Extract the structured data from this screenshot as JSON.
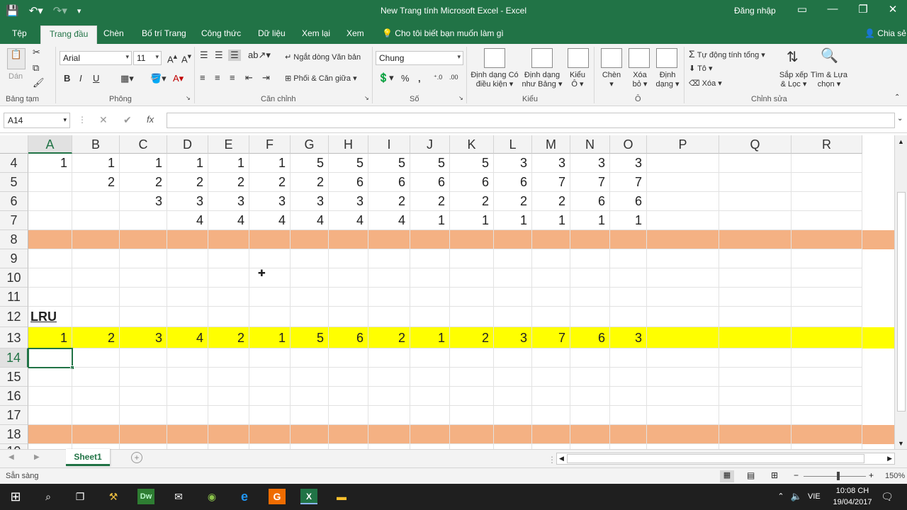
{
  "window": {
    "title": "New Trang tính Microsoft Excel  -  Excel",
    "sign_in": "Đăng nhập",
    "share": "Chia sẻ"
  },
  "tabs": [
    "Tệp",
    "Trang đầu",
    "Chèn",
    "Bố trí Trang",
    "Công thức",
    "Dữ liệu",
    "Xem lại",
    "Xem"
  ],
  "active_tab": "Trang đầu",
  "tell_me": "Cho tôi biết bạn muốn làm gì",
  "ribbon": {
    "clipboard": {
      "paste": "Dán",
      "label": "Bảng tạm"
    },
    "font": {
      "name": "Arial",
      "size": "11",
      "bold": "B",
      "italic": "I",
      "underline": "U",
      "label": "Phông"
    },
    "alignment": {
      "wrap": "Ngắt dòng Văn bản",
      "merge": "Phối & Căn giữa",
      "label": "Căn chỉnh"
    },
    "number": {
      "format": "Chung",
      "percent": "%",
      "comma": ",",
      "label": "Số"
    },
    "styles": {
      "conditional_1": "Định dạng Có",
      "conditional_2": "điều kiện",
      "table_1": "Định dạng",
      "table_2": "như Bảng",
      "cell_1": "Kiểu",
      "cell_2": "Ô",
      "label": "Kiểu"
    },
    "cells": {
      "insert": "Chèn",
      "delete_1": "Xóa",
      "delete_2": "bỏ",
      "format_1": "Định",
      "format_2": "dạng",
      "label": "Ô"
    },
    "editing": {
      "autosum": "Tự động tính tổng",
      "fill": "Tô",
      "clear": "Xóa",
      "sort_1": "Sắp xếp",
      "sort_2": "& Lọc",
      "find_1": "Tìm & Lựa",
      "find_2": "chọn",
      "label": "Chỉnh sửa"
    }
  },
  "formula_bar": {
    "name_box": "A14",
    "fx": "fx",
    "value": ""
  },
  "columns": [
    "A",
    "B",
    "C",
    "D",
    "E",
    "F",
    "G",
    "H",
    "I",
    "J",
    "K",
    "L",
    "M",
    "N",
    "O",
    "P",
    "Q",
    "R"
  ],
  "selected_column": "A",
  "rows": [
    {
      "num": "4",
      "cells": [
        "1",
        "1",
        "1",
        "1",
        "1",
        "1",
        "5",
        "5",
        "5",
        "5",
        "5",
        "3",
        "3",
        "3",
        "3"
      ]
    },
    {
      "num": "5",
      "cells": [
        "",
        "2",
        "2",
        "2",
        "2",
        "2",
        "2",
        "6",
        "6",
        "6",
        "6",
        "6",
        "7",
        "7",
        "7"
      ]
    },
    {
      "num": "6",
      "cells": [
        "",
        "",
        "3",
        "3",
        "3",
        "3",
        "3",
        "3",
        "2",
        "2",
        "2",
        "2",
        "2",
        "6",
        "6"
      ]
    },
    {
      "num": "7",
      "cells": [
        "",
        "",
        "",
        "4",
        "4",
        "4",
        "4",
        "4",
        "4",
        "1",
        "1",
        "1",
        "1",
        "1",
        "1"
      ]
    },
    {
      "num": "8",
      "cells": [],
      "fill": "#f4b183"
    },
    {
      "num": "9",
      "cells": []
    },
    {
      "num": "10",
      "cells": []
    },
    {
      "num": "11",
      "cells": []
    },
    {
      "num": "12",
      "cells": [],
      "label": "LRU"
    },
    {
      "num": "13",
      "cells": [
        "1",
        "2",
        "3",
        "4",
        "2",
        "1",
        "5",
        "6",
        "2",
        "1",
        "2",
        "3",
        "7",
        "6",
        "3"
      ],
      "fill": "#ffff00"
    },
    {
      "num": "14",
      "cells": [],
      "selected": true
    },
    {
      "num": "15",
      "cells": []
    },
    {
      "num": "16",
      "cells": []
    },
    {
      "num": "17",
      "cells": []
    },
    {
      "num": "18",
      "cells": [],
      "fill": "#f4b183"
    },
    {
      "num": "19",
      "cells": []
    }
  ],
  "sheet_tab": "Sheet1",
  "status": {
    "ready": "Sẵn sàng",
    "zoom": "150%"
  },
  "taskbar": {
    "lang": "VIE",
    "time": "10:08 CH",
    "date": "19/04/2017"
  },
  "colors": {
    "accent": "#217346",
    "orange_band": "#f4b183",
    "yellow_band": "#ffff00"
  }
}
